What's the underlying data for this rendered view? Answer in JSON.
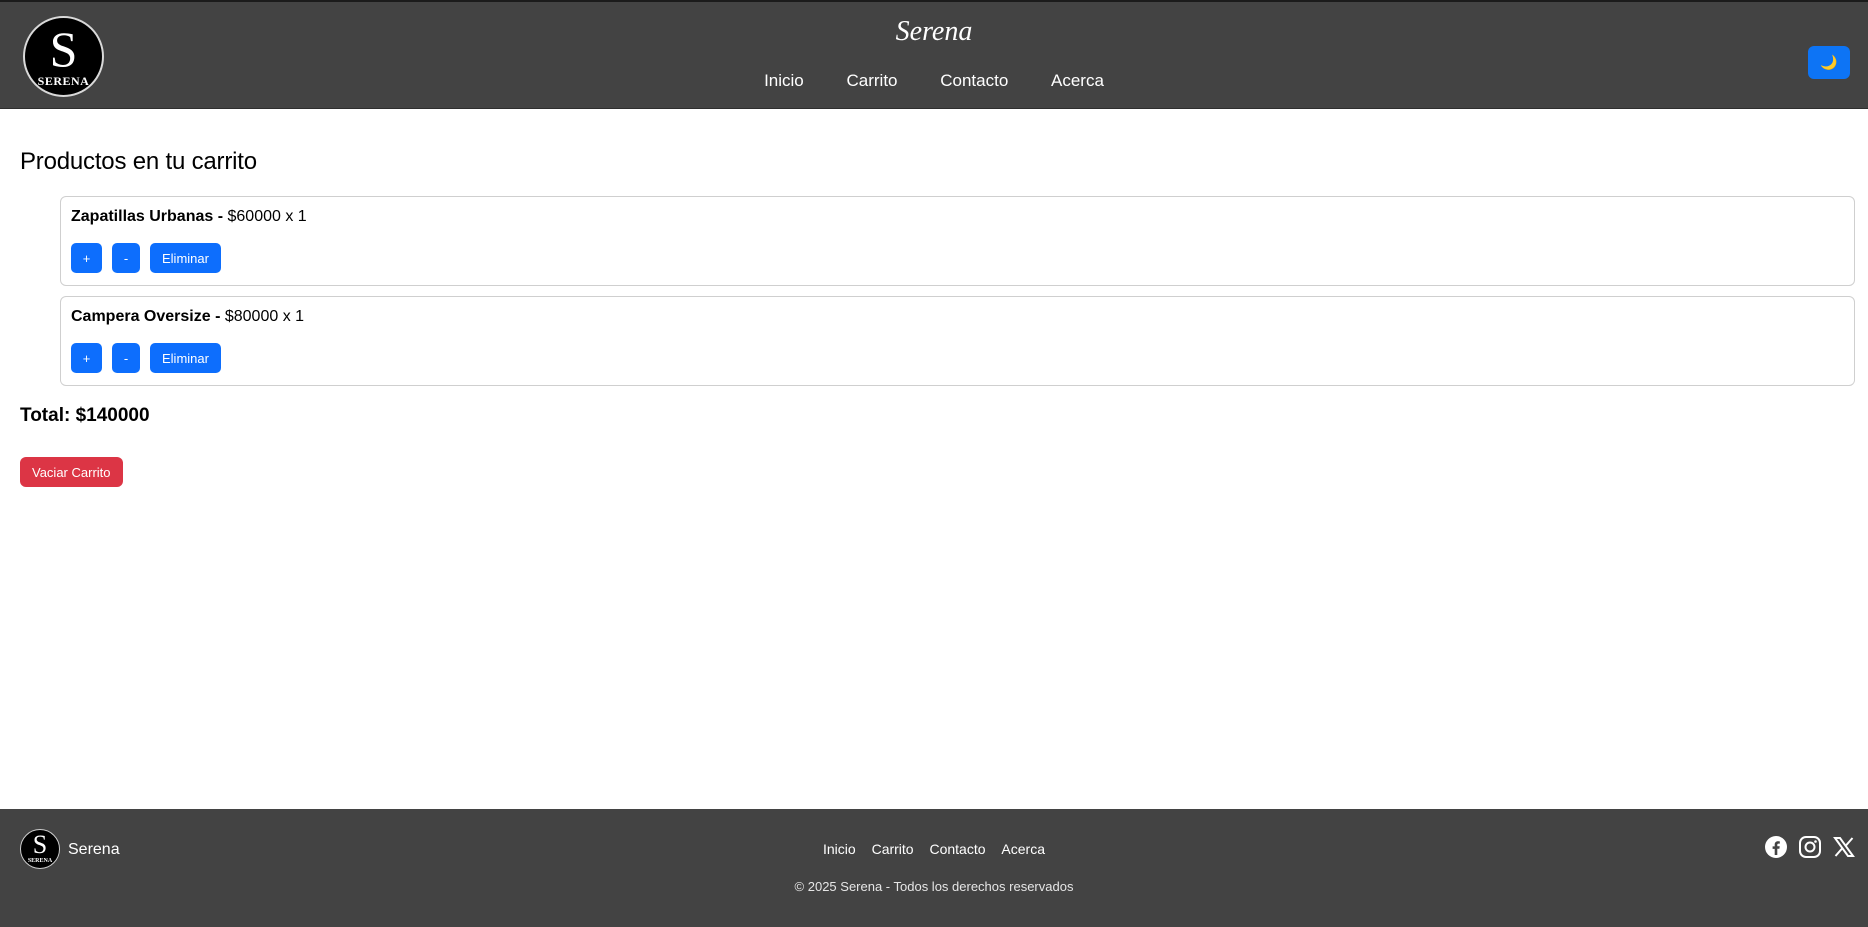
{
  "header": {
    "logo_letter": "S",
    "logo_text": "SERENA",
    "brand": "Serena",
    "nav": [
      "Inicio",
      "Carrito",
      "Contacto",
      "Acerca"
    ],
    "theme_icon": "moon-icon",
    "theme_symbol": "🌙"
  },
  "main": {
    "title": "Productos en tu carrito",
    "items": [
      {
        "name": "Zapatillas Urbanas",
        "separator": " - ",
        "detail": "$60000 x 1",
        "plus": "+",
        "minus": "-",
        "remove": "Eliminar"
      },
      {
        "name": "Campera Oversize",
        "separator": " - ",
        "detail": "$80000 x 1",
        "plus": "+",
        "minus": "-",
        "remove": "Eliminar"
      }
    ],
    "total": "Total: $140000",
    "clear_button": "Vaciar Carrito"
  },
  "footer": {
    "logo_letter": "S",
    "logo_text": "SERENA",
    "brand": "Serena",
    "nav": [
      "Inicio",
      "Carrito",
      "Contacto",
      "Acerca"
    ],
    "copyright": "© 2025 Serena - Todos los derechos reservados",
    "social_icons": [
      "facebook-icon",
      "instagram-icon",
      "x-icon"
    ]
  },
  "colors": {
    "header_bg": "#434343",
    "primary": "#0d6efd",
    "danger": "#dc3545"
  }
}
